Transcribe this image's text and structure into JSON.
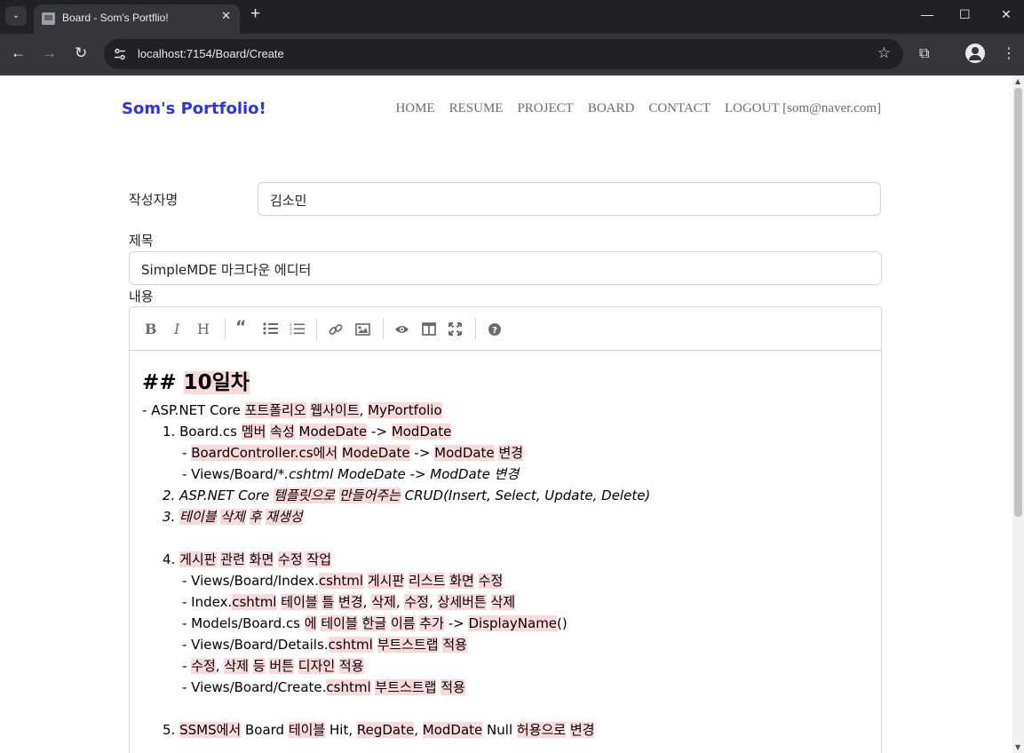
{
  "browser": {
    "tab_title": "Board - Som's Portflio!",
    "tab_close": "✕",
    "new_tab": "+",
    "tab_list": "⌄",
    "url": "localhost:7154/Board/Create",
    "back": "←",
    "forward": "→",
    "reload": "↻",
    "bookmark": "☆",
    "extensions": "⧉",
    "menu": "⋮",
    "minimize": "—",
    "maximize": "☐",
    "close": "✕"
  },
  "site": {
    "brand": "Som's Portfolio!",
    "nav": [
      "HOME",
      "RESUME",
      "PROJECT",
      "BOARD",
      "CONTACT",
      "LOGOUT [som@naver.com]"
    ]
  },
  "form": {
    "author_label": "작성자명",
    "author_value": "김소민",
    "title_label": "제목",
    "title_value": "SimpleMDE 마크다운 에디터",
    "content_label": "내용"
  },
  "editor": {
    "toolbar": [
      "bold",
      "italic",
      "heading",
      "quote",
      "unordered-list",
      "ordered-list",
      "link",
      "image",
      "preview",
      "side-by-side",
      "fullscreen",
      "guide"
    ],
    "heading_prefix": "## ",
    "heading_text": "10일차",
    "lines": [
      {
        "indent": 0,
        "em": false,
        "segs": [
          [
            "- ",
            false
          ],
          [
            "ASP.NET Core ",
            false
          ],
          [
            "포트폴리오",
            true
          ],
          [
            " ",
            false
          ],
          [
            "웹사이트",
            true
          ],
          [
            ", ",
            false
          ],
          [
            "MyPortfolio",
            true
          ]
        ]
      },
      {
        "indent": 1,
        "em": false,
        "segs": [
          [
            "1. Board.cs ",
            false
          ],
          [
            "멤버",
            true
          ],
          [
            " ",
            false
          ],
          [
            "속성",
            true
          ],
          [
            " ",
            false
          ],
          [
            "ModeDate",
            true
          ],
          [
            " -> ",
            false
          ],
          [
            "ModDate",
            true
          ]
        ]
      },
      {
        "indent": 2,
        "em": false,
        "segs": [
          [
            "- ",
            false
          ],
          [
            "BoardController.cs에서",
            true
          ],
          [
            " ",
            false
          ],
          [
            "ModeDate",
            true
          ],
          [
            " -> ",
            false
          ],
          [
            "ModDate",
            true
          ],
          [
            " ",
            false
          ],
          [
            "변경",
            true
          ]
        ]
      },
      {
        "indent": 2,
        "em": false,
        "segs": [
          [
            "- Views/Board/",
            false
          ],
          [
            "*.cshtml ModeDate -> ModDate 변경",
            "em"
          ]
        ]
      },
      {
        "indent": 1,
        "em": true,
        "segs": [
          [
            "2. ASP.NET Core ",
            false
          ],
          [
            "템플릿으로",
            true
          ],
          [
            " ",
            false
          ],
          [
            "만들어주는",
            true
          ],
          [
            " CRUD(Insert, Select, Update, Delete)",
            false
          ]
        ]
      },
      {
        "indent": 1,
        "em": true,
        "segs": [
          [
            "3. ",
            false
          ],
          [
            "테이블",
            true
          ],
          [
            " ",
            false
          ],
          [
            "삭제",
            true
          ],
          [
            " ",
            false
          ],
          [
            "후",
            true
          ],
          [
            " ",
            false
          ],
          [
            "재생성",
            true
          ]
        ]
      },
      {
        "indent": 0,
        "em": false,
        "segs": [
          [
            "",
            false
          ]
        ]
      },
      {
        "indent": 1,
        "em": false,
        "segs": [
          [
            "4. ",
            false
          ],
          [
            "게시판",
            true
          ],
          [
            " ",
            false
          ],
          [
            "관련",
            true
          ],
          [
            " ",
            false
          ],
          [
            "화면",
            true
          ],
          [
            " ",
            false
          ],
          [
            "수정",
            true
          ],
          [
            " ",
            false
          ],
          [
            "작업",
            true
          ]
        ]
      },
      {
        "indent": 2,
        "em": false,
        "segs": [
          [
            "- Views/Board/Index.",
            false
          ],
          [
            "cshtml",
            true
          ],
          [
            " ",
            false
          ],
          [
            "게시판",
            true
          ],
          [
            " ",
            false
          ],
          [
            "리스트",
            true
          ],
          [
            " ",
            false
          ],
          [
            "화면",
            true
          ],
          [
            " ",
            false
          ],
          [
            "수정",
            true
          ]
        ]
      },
      {
        "indent": 2,
        "em": false,
        "segs": [
          [
            "- Index.",
            false
          ],
          [
            "cshtml",
            true
          ],
          [
            " ",
            false
          ],
          [
            "테이블",
            true
          ],
          [
            " ",
            false
          ],
          [
            "틀",
            true
          ],
          [
            " ",
            false
          ],
          [
            "변경",
            true
          ],
          [
            ", ",
            false
          ],
          [
            "삭제",
            true
          ],
          [
            ", ",
            false
          ],
          [
            "수정",
            true
          ],
          [
            ", ",
            false
          ],
          [
            "상세버튼",
            true
          ],
          [
            " ",
            false
          ],
          [
            "삭제",
            true
          ]
        ]
      },
      {
        "indent": 2,
        "em": false,
        "segs": [
          [
            "- Models/Board.cs ",
            false
          ],
          [
            "에",
            true
          ],
          [
            " ",
            false
          ],
          [
            "테이블",
            true
          ],
          [
            " ",
            false
          ],
          [
            "한글",
            true
          ],
          [
            " ",
            false
          ],
          [
            "이름",
            true
          ],
          [
            " ",
            false
          ],
          [
            "추가",
            true
          ],
          [
            " -> ",
            false
          ],
          [
            "DisplayName",
            true
          ],
          [
            "()",
            false
          ]
        ]
      },
      {
        "indent": 2,
        "em": false,
        "segs": [
          [
            "- Views/Board/Details.",
            false
          ],
          [
            "cshtml",
            true
          ],
          [
            " ",
            false
          ],
          [
            "부트스트랩",
            true
          ],
          [
            " ",
            false
          ],
          [
            "적용",
            true
          ]
        ]
      },
      {
        "indent": 2,
        "em": false,
        "segs": [
          [
            "- ",
            false
          ],
          [
            "수정",
            true
          ],
          [
            ", ",
            false
          ],
          [
            "삭제",
            true
          ],
          [
            " ",
            false
          ],
          [
            "등",
            true
          ],
          [
            " ",
            false
          ],
          [
            "버튼",
            true
          ],
          [
            " ",
            false
          ],
          [
            "디자인",
            true
          ],
          [
            " ",
            false
          ],
          [
            "적용",
            true
          ]
        ]
      },
      {
        "indent": 2,
        "em": false,
        "segs": [
          [
            "- Views/Board/Create.",
            false
          ],
          [
            "cshtml",
            true
          ],
          [
            " ",
            false
          ],
          [
            "부트스트랩",
            true
          ],
          [
            " ",
            false
          ],
          [
            "적용",
            true
          ]
        ]
      },
      {
        "indent": 0,
        "em": false,
        "segs": [
          [
            "",
            false
          ]
        ]
      },
      {
        "indent": 1,
        "em": false,
        "segs": [
          [
            "5. ",
            false
          ],
          [
            "SSMS에서",
            true
          ],
          [
            " Board ",
            false
          ],
          [
            "테이블",
            true
          ],
          [
            " Hit, ",
            false
          ],
          [
            "RegDate",
            true
          ],
          [
            ", ",
            false
          ],
          [
            "ModDate",
            true
          ],
          [
            " Null ",
            false
          ],
          [
            "허용으로",
            true
          ],
          [
            " ",
            false
          ],
          [
            "변경",
            true
          ]
        ]
      }
    ]
  }
}
